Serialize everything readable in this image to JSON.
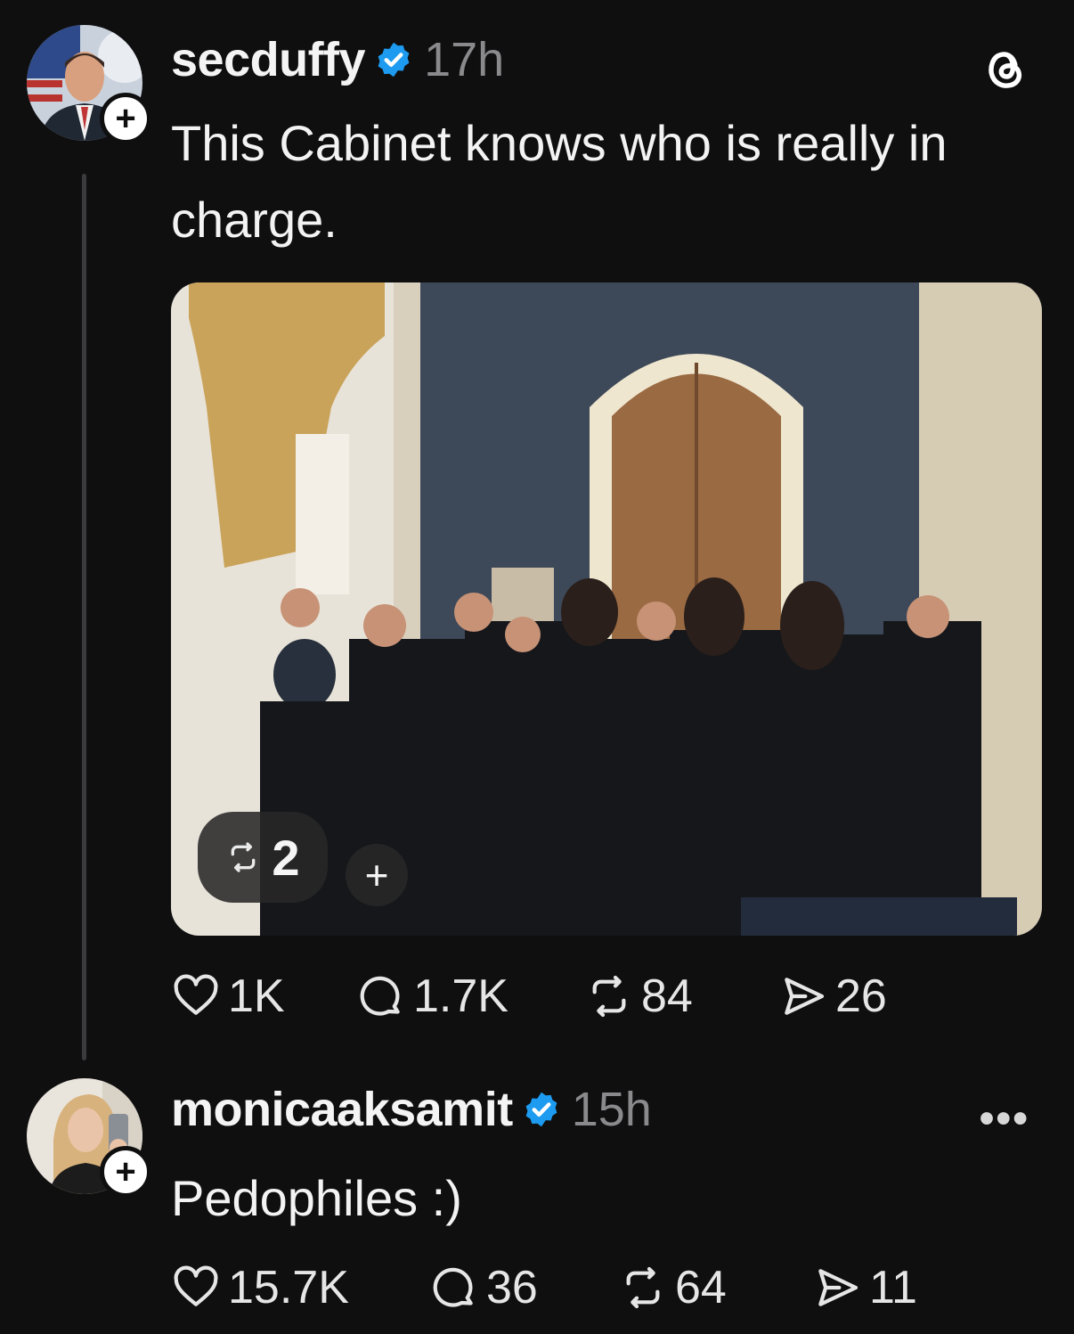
{
  "posts": [
    {
      "username": "secduffy",
      "time": "17h",
      "text": "This Cabinet knows who is really in charge.",
      "media": {
        "repost_count": "2"
      },
      "stats": {
        "likes": "1K",
        "replies": "1.7K",
        "reposts": "84",
        "shares": "26"
      }
    },
    {
      "username": "monicaaksamit",
      "time": "15h",
      "text": "Pedophiles :)",
      "more_label": "•••",
      "stats": {
        "likes": "15.7K",
        "replies": "36",
        "reposts": "64",
        "shares": "11"
      }
    }
  ],
  "follow_label": "+",
  "colors": {
    "background": "#0f0f10",
    "verified": "#1d9bf0",
    "muted": "#8a8a8d"
  },
  "icons": [
    "threads-logo-icon",
    "verified-icon",
    "heart-icon",
    "reply-icon",
    "repost-icon",
    "share-icon"
  ]
}
